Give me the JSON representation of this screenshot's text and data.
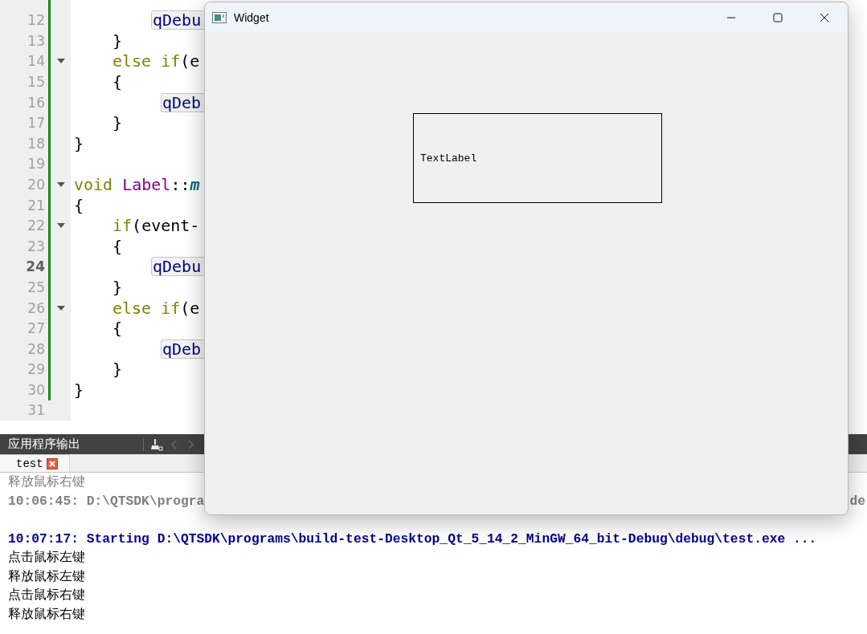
{
  "editor": {
    "lines": [
      {
        "number": "12",
        "kind": "body",
        "modified": true,
        "fold": false,
        "current": false,
        "tokens": [
          {
            "kind": "debug",
            "text": "qDebu"
          }
        ]
      },
      {
        "number": "13",
        "kind": "block",
        "modified": true,
        "fold": false,
        "current": false,
        "tokens": [
          {
            "kind": "plain",
            "text": "}"
          }
        ]
      },
      {
        "number": "14",
        "kind": "block",
        "modified": true,
        "fold": true,
        "current": false,
        "tokens": [
          {
            "kind": "keyword",
            "text": "else if"
          },
          {
            "kind": "plain",
            "text": "(e"
          }
        ]
      },
      {
        "number": "15",
        "kind": "block",
        "modified": true,
        "fold": false,
        "current": false,
        "tokens": [
          {
            "kind": "plain",
            "text": "{"
          }
        ]
      },
      {
        "number": "16",
        "kind": "body-shifted",
        "modified": true,
        "fold": false,
        "current": false,
        "tokens": [
          {
            "kind": "debug",
            "text": "qDeb"
          }
        ]
      },
      {
        "number": "17",
        "kind": "block",
        "modified": true,
        "fold": false,
        "current": false,
        "tokens": [
          {
            "kind": "plain",
            "text": "}"
          }
        ]
      },
      {
        "number": "18",
        "kind": "outer",
        "modified": true,
        "fold": false,
        "current": false,
        "tokens": [
          {
            "kind": "plain",
            "text": "}"
          }
        ]
      },
      {
        "number": "19",
        "kind": "outer",
        "modified": true,
        "fold": false,
        "current": false
      },
      {
        "number": "20",
        "kind": "outer",
        "modified": true,
        "fold": true,
        "current": false,
        "tokens": [
          {
            "kind": "keyword",
            "text": "void"
          },
          {
            "kind": "type",
            "text": "Label"
          },
          {
            "kind": "plain",
            "text": "::"
          },
          {
            "kind": "function",
            "text": "m"
          }
        ]
      },
      {
        "number": "21",
        "kind": "outer",
        "modified": true,
        "fold": false,
        "current": false,
        "tokens": [
          {
            "kind": "plain",
            "text": "{"
          }
        ]
      },
      {
        "number": "22",
        "kind": "block",
        "modified": true,
        "fold": true,
        "current": false,
        "tokens": [
          {
            "kind": "keyword",
            "text": "if"
          },
          {
            "kind": "plain",
            "text": "(event-"
          }
        ]
      },
      {
        "number": "23",
        "kind": "block",
        "modified": true,
        "fold": false,
        "current": false,
        "tokens": [
          {
            "kind": "plain",
            "text": "{"
          }
        ]
      },
      {
        "number": "24",
        "kind": "body",
        "modified": true,
        "fold": false,
        "current": true,
        "tokens": [
          {
            "kind": "debug",
            "text": "qDebu"
          }
        ]
      },
      {
        "number": "25",
        "kind": "block",
        "modified": true,
        "fold": false,
        "current": false,
        "tokens": [
          {
            "kind": "plain",
            "text": "}"
          }
        ]
      },
      {
        "number": "26",
        "kind": "block",
        "modified": true,
        "fold": true,
        "current": false,
        "tokens": [
          {
            "kind": "keyword",
            "text": "else if"
          },
          {
            "kind": "plain",
            "text": "(e"
          }
        ]
      },
      {
        "number": "27",
        "kind": "block",
        "modified": true,
        "fold": false,
        "current": false,
        "tokens": [
          {
            "kind": "plain",
            "text": "{"
          }
        ]
      },
      {
        "number": "28",
        "kind": "body-shifted",
        "modified": true,
        "fold": false,
        "current": false,
        "tokens": [
          {
            "kind": "debug",
            "text": "qDeb"
          }
        ]
      },
      {
        "number": "29",
        "kind": "block",
        "modified": true,
        "fold": false,
        "current": false,
        "tokens": [
          {
            "kind": "plain",
            "text": "}"
          }
        ]
      },
      {
        "number": "30",
        "kind": "outer",
        "modified": true,
        "fold": false,
        "current": false,
        "tokens": [
          {
            "kind": "plain",
            "text": "}"
          }
        ]
      },
      {
        "number": "31",
        "kind": "outer",
        "modified": false,
        "fold": false,
        "current": false
      }
    ]
  },
  "output_pane": {
    "title": "应用程序输出",
    "tabs": [
      {
        "label": "test",
        "selected": true
      }
    ],
    "lines": [
      {
        "kind": "old",
        "text": "释放鼠标右键"
      },
      {
        "kind": "covered",
        "text": "10:06:45: D:\\QTSDK\\progra",
        "text_end": "de"
      },
      {
        "kind": "blank"
      },
      {
        "kind": "start",
        "text": "10:07:17: Starting D:\\QTSDK\\programs\\build-test-Desktop_Qt_5_14_2_MinGW_64_bit-Debug\\debug\\test.exe ..."
      },
      {
        "kind": "plain",
        "text": "点击鼠标左键"
      },
      {
        "kind": "plain",
        "text": "释放鼠标左键"
      },
      {
        "kind": "plain",
        "text": "点击鼠标右键"
      },
      {
        "kind": "plain",
        "text": "释放鼠标右键"
      }
    ]
  },
  "widget_window": {
    "title": "Widget",
    "label": "TextLabel"
  }
}
